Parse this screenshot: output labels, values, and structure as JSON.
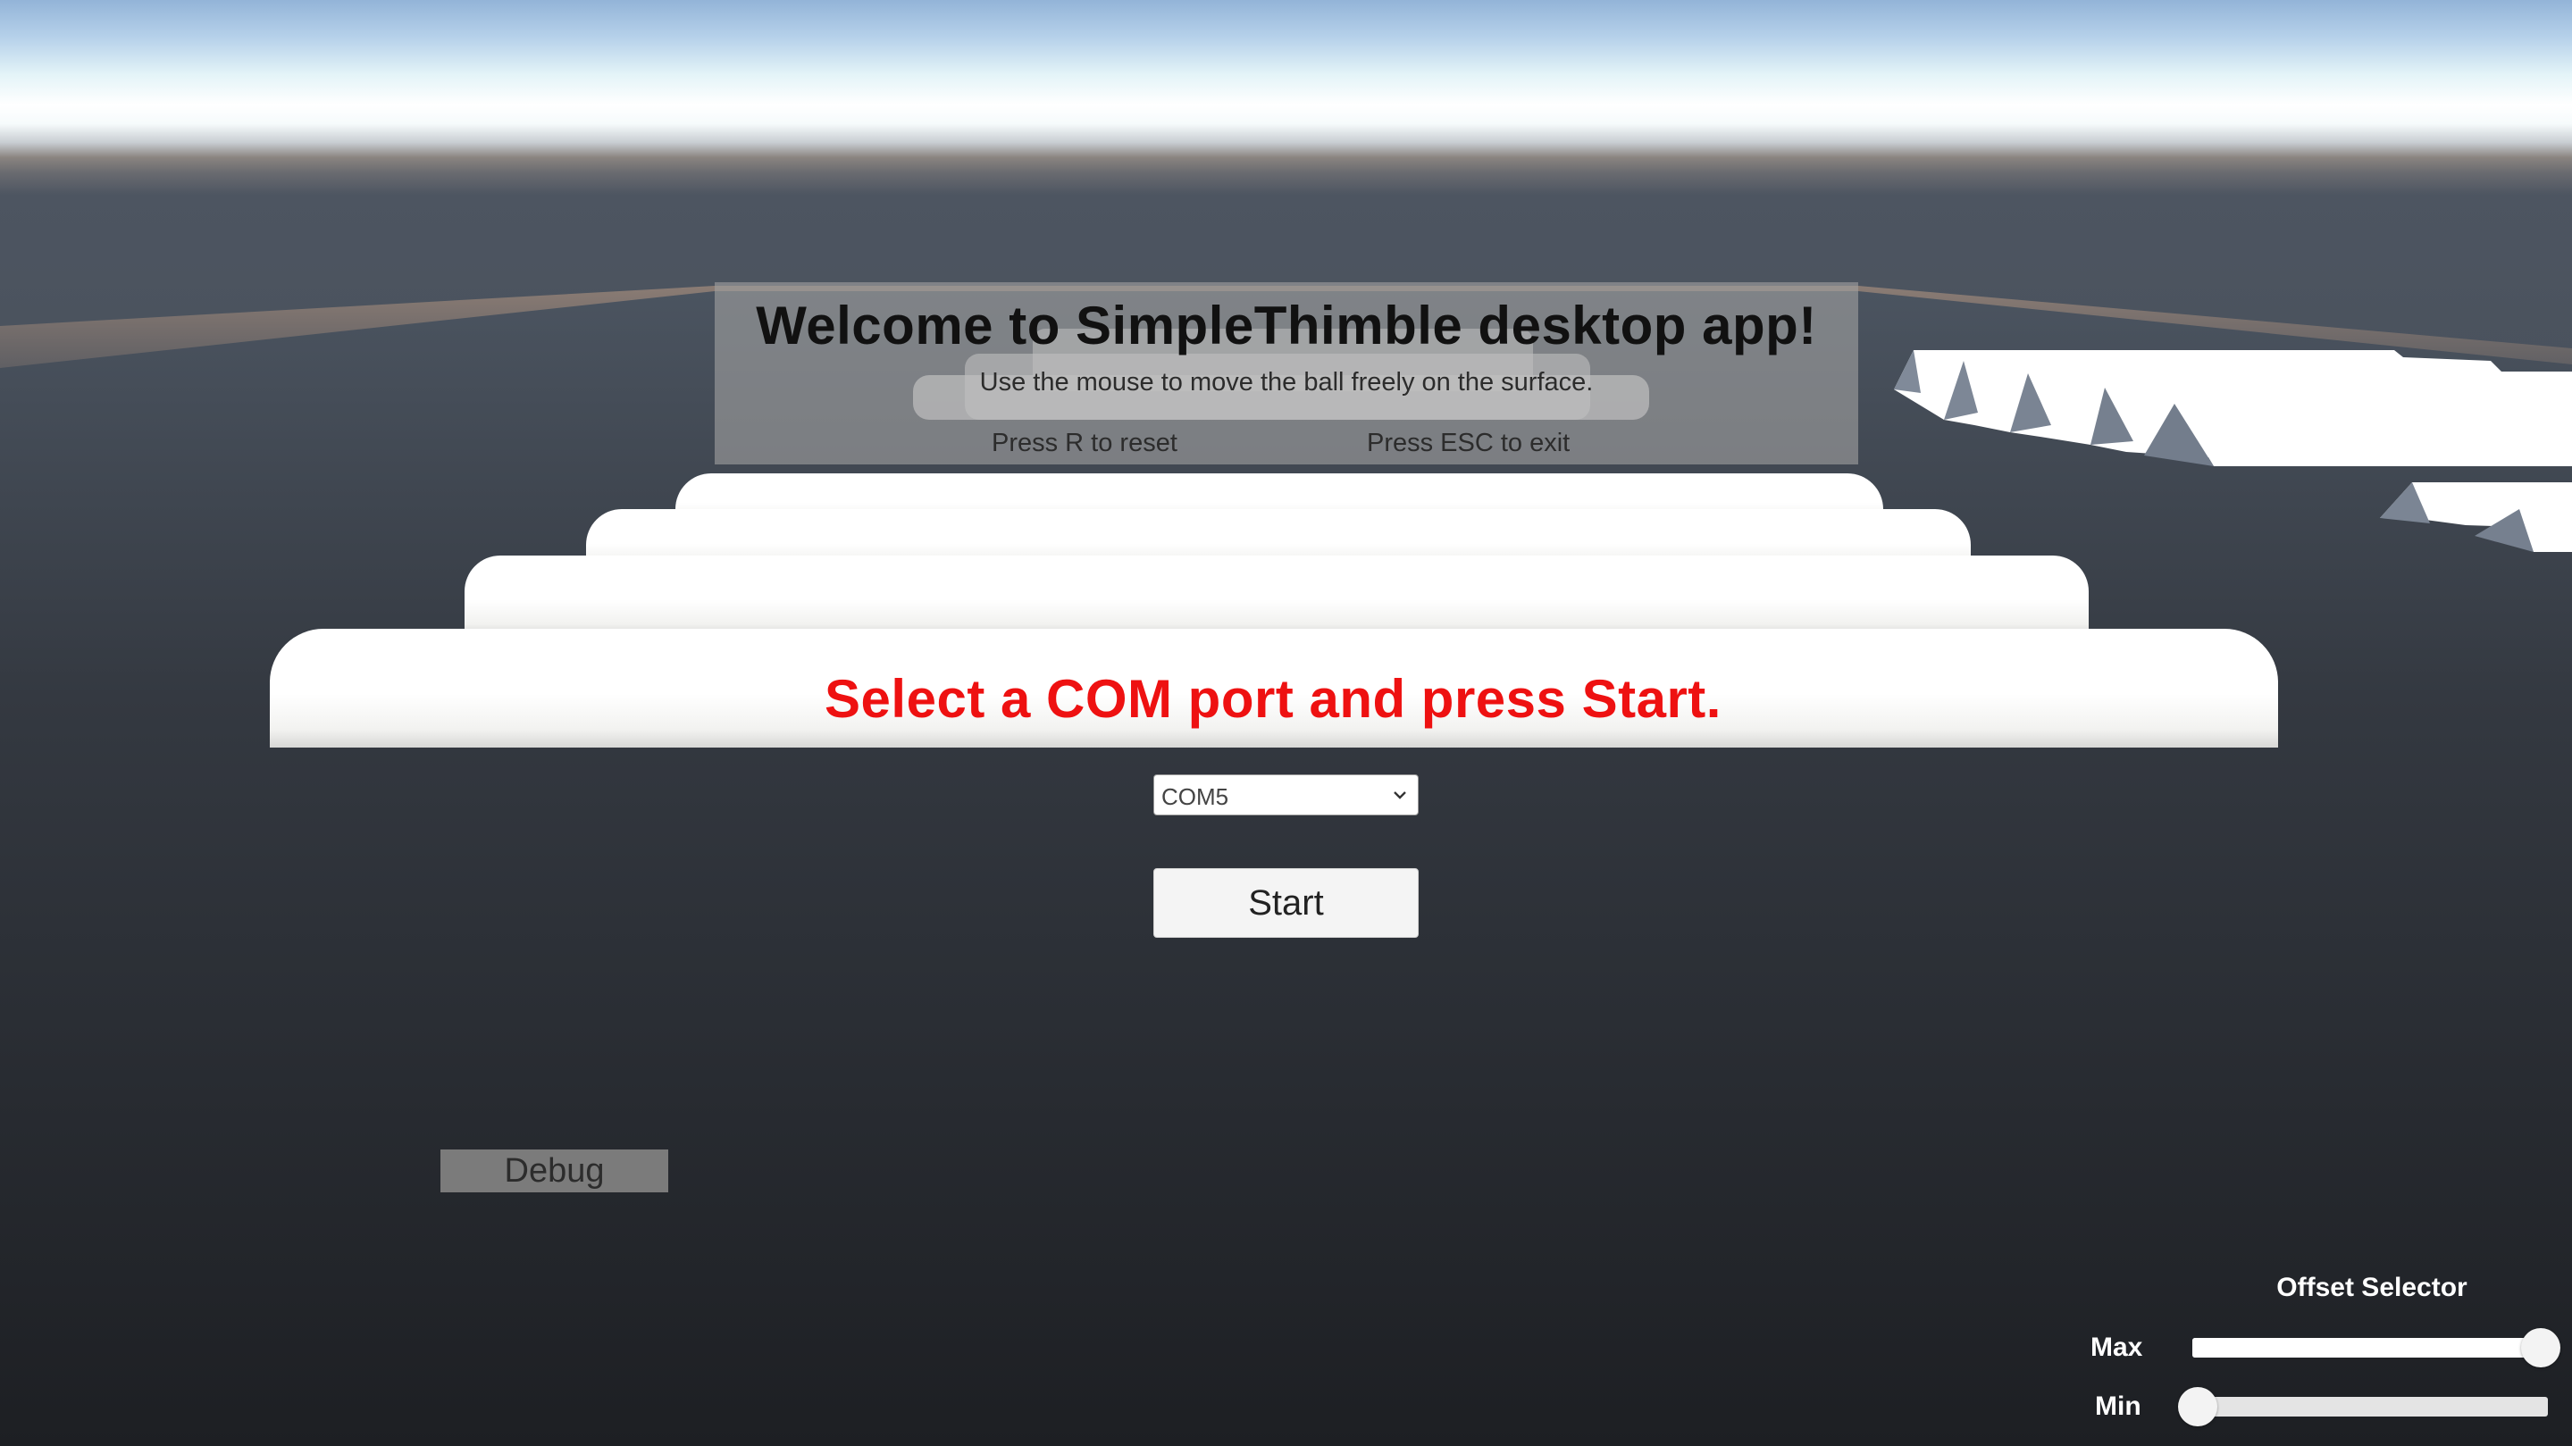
{
  "welcome": {
    "title": "Welcome to SimpleThimble desktop app!",
    "subtitle": "Use the mouse to move the ball freely on the surface.",
    "hint_reset": "Press R to reset",
    "hint_exit": "Press ESC to exit"
  },
  "prompt": {
    "text": "Select a COM port and press Start.",
    "color": "#ee1111"
  },
  "com_port": {
    "selected": "COM5",
    "arrow_icon": "chevron-down-icon"
  },
  "start_button": {
    "label": "Start"
  },
  "debug_button": {
    "label": "Debug"
  },
  "offset_selector": {
    "title": "Offset Selector",
    "max": {
      "label": "Max",
      "value_fraction": 1.0
    },
    "min": {
      "label": "Min",
      "value_fraction": 0.0
    }
  }
}
